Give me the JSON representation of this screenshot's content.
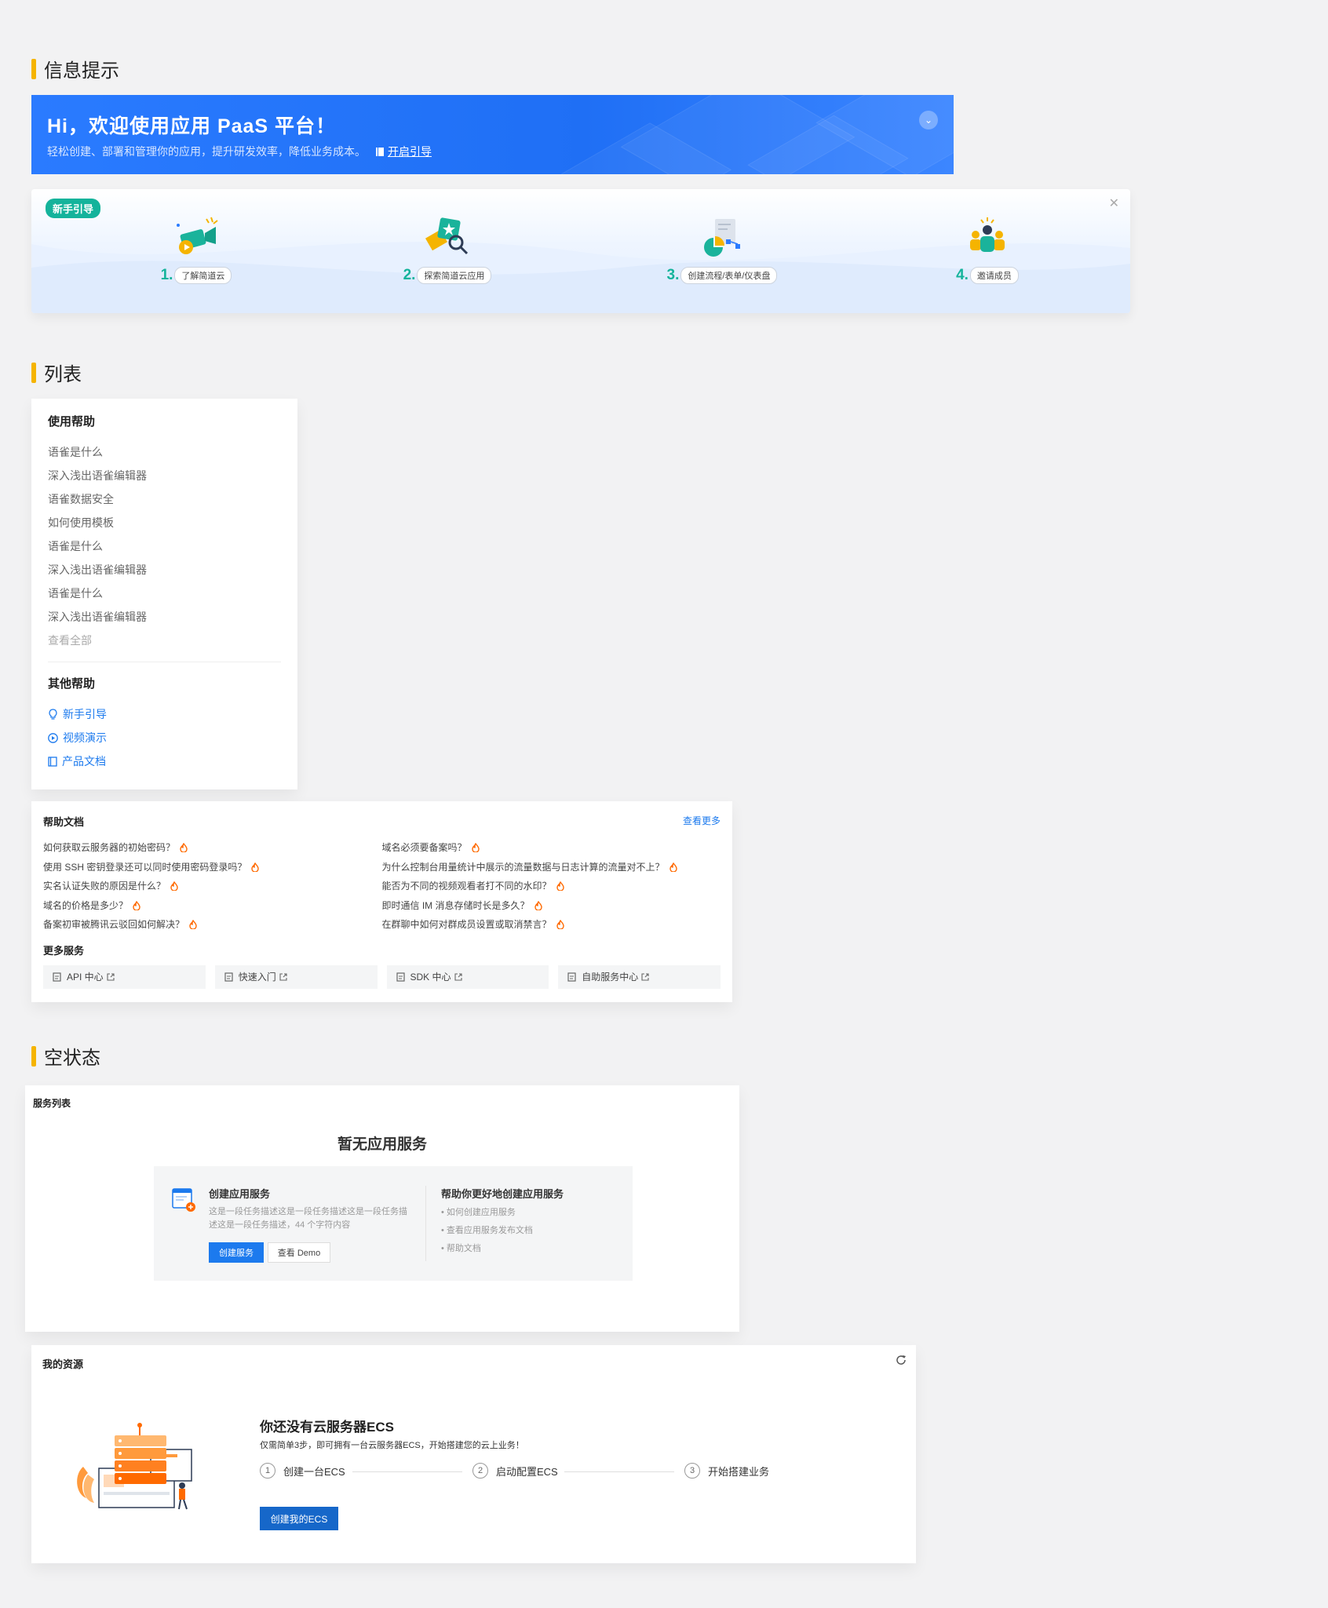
{
  "sections": {
    "info": "信息提示",
    "list": "列表",
    "empty": "空状态"
  },
  "banner": {
    "title": "Hi，欢迎使用应用 PaaS 平台！",
    "subtitle": "轻松创建、部署和管理你的应用，提升研发效率，降低业务成本。",
    "link": "开启引导"
  },
  "guide": {
    "tag": "新手引导",
    "steps": [
      {
        "num": "1.",
        "label": "了解简道云"
      },
      {
        "num": "2.",
        "label": "探索简道云应用"
      },
      {
        "num": "3.",
        "label": "创建流程/表单/仪表盘"
      },
      {
        "num": "4.",
        "label": "邀请成员"
      }
    ]
  },
  "help": {
    "title": "使用帮助",
    "items": [
      "语雀是什么",
      "深入浅出语雀编辑器",
      "语雀数据安全",
      "如何使用模板",
      "语雀是什么",
      "深入浅出语雀编辑器",
      "语雀是什么",
      "深入浅出语雀编辑器"
    ],
    "view_all": "查看全部",
    "other_title": "其他帮助",
    "other": [
      {
        "icon": "lightbulb-icon",
        "label": "新手引导"
      },
      {
        "icon": "play-circle-icon",
        "label": "视频演示"
      },
      {
        "icon": "book-icon",
        "label": "产品文档"
      }
    ]
  },
  "docs": {
    "title": "帮助文档",
    "more": "查看更多",
    "left": [
      "如何获取云服务器的初始密码？",
      "使用 SSH 密钥登录还可以同时使用密码登录吗？",
      "实名认证失败的原因是什么？",
      "域名的价格是多少？",
      "备案初审被腾讯云驳回如何解决？"
    ],
    "right": [
      "域名必须要备案吗？",
      "为什么控制台用量统计中展示的流量数据与日志计算的流量对不上？",
      "能否为不同的视频观看者打不同的水印？",
      "即时通信 IM 消息存储时长是多久？",
      "在群聊中如何对群成员设置或取消禁言？"
    ],
    "services_title": "更多服务",
    "services": [
      "API 中心",
      "快速入门",
      "SDK 中心",
      "自助服务中心"
    ]
  },
  "service_list": {
    "title": "服务列表",
    "empty_title": "暂无应用服务",
    "create_title": "创建应用服务",
    "create_desc": "这是一段任务描述这是一段任务描述这是一段任务描述这是一段任务描述，44 个字符内容",
    "create_btn": "创建服务",
    "demo_btn": "查看 Demo",
    "help_title": "帮助你更好地创建应用服务",
    "help_links": [
      "• 如何创建应用服务",
      "• 查看应用服务发布文档",
      "• 帮助文档"
    ]
  },
  "resources": {
    "title": "我的资源",
    "heading": "你还没有云服务器ECS",
    "desc": "仅需简单3步，即可拥有一台云服务器ECS，开始搭建您的云上业务！",
    "steps": [
      {
        "n": "1",
        "label": "创建一台ECS"
      },
      {
        "n": "2",
        "label": "启动配置ECS"
      },
      {
        "n": "3",
        "label": "开始搭建业务"
      }
    ],
    "button": "创建我的ECS"
  },
  "colors": {
    "accent": "#1c7aee",
    "brand_blue": "#2a7bff",
    "teal": "#14b39b",
    "marker": "#f5b400"
  }
}
